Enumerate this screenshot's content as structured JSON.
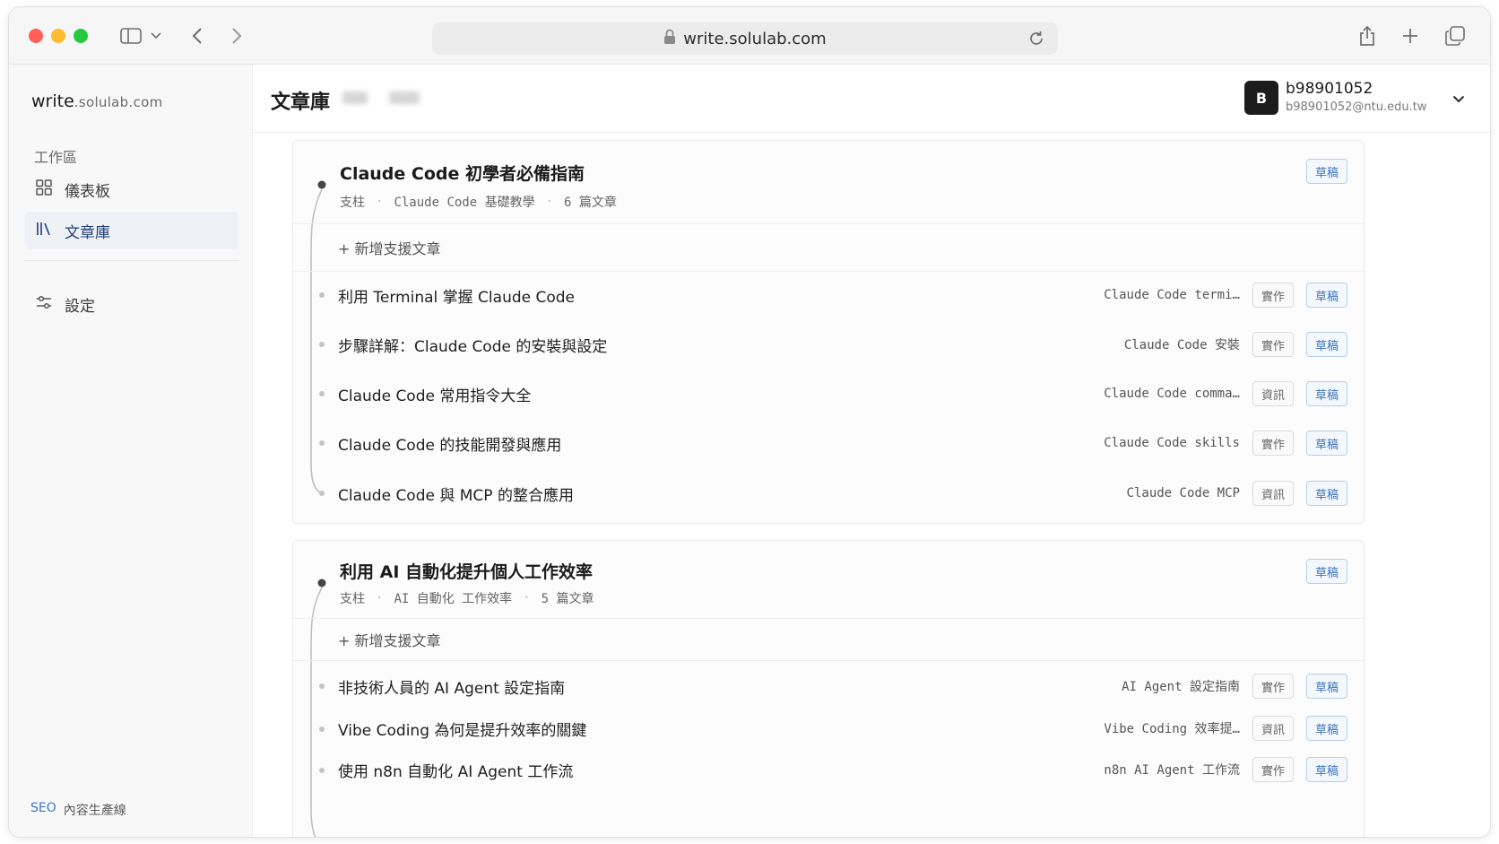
{
  "browser": {
    "url": "write.solulab.com"
  },
  "sidebar": {
    "brand_name": "write",
    "brand_domain": ".solulab.com",
    "section_label": "工作區",
    "items": [
      {
        "label": "儀表板",
        "icon": "grid-icon"
      },
      {
        "label": "文章庫",
        "icon": "library-icon",
        "active": true
      },
      {
        "label": "設定",
        "icon": "sliders-icon"
      }
    ],
    "footer_seo": "SEO",
    "footer_text": "內容生產線"
  },
  "header": {
    "title": "文章庫",
    "user_initial": "B",
    "user_name": "b98901052",
    "user_email": "b98901052@ntu.edu.tw"
  },
  "pillars": [
    {
      "title": "Claude Code 初學者必備指南",
      "kind": "支柱",
      "keyword": "Claude Code 基礎教學",
      "count": "6 篇文章",
      "status": "草稿",
      "add_label": "+ 新增支援文章",
      "articles": [
        {
          "title": "利用 Terminal 掌握 Claude Code",
          "keyword": "Claude Code termi…",
          "type": "實作",
          "status": "草稿"
        },
        {
          "title": "步驟詳解：Claude Code 的安裝與設定",
          "keyword": "Claude Code 安裝",
          "type": "實作",
          "status": "草稿"
        },
        {
          "title": "Claude Code 常用指令大全",
          "keyword": "Claude Code comma…",
          "type": "資訊",
          "status": "草稿"
        },
        {
          "title": "Claude Code 的技能開發與應用",
          "keyword": "Claude Code skills",
          "type": "實作",
          "status": "草稿"
        },
        {
          "title": "Claude Code 與 MCP 的整合應用",
          "keyword": "Claude Code MCP",
          "type": "資訊",
          "status": "草稿"
        }
      ]
    },
    {
      "title": "利用 AI 自動化提升個人工作效率",
      "kind": "支柱",
      "keyword": "AI 自動化 工作效率",
      "count": "5 篇文章",
      "status": "草稿",
      "add_label": "+ 新增支援文章",
      "articles": [
        {
          "title": "非技術人員的 AI Agent 設定指南",
          "keyword": "AI Agent 設定指南",
          "type": "實作",
          "status": "草稿"
        },
        {
          "title": "Vibe Coding 為何是提升效率的關鍵",
          "keyword": "Vibe Coding 效率提…",
          "type": "資訊",
          "status": "草稿"
        },
        {
          "title": "使用 n8n 自動化 AI Agent 工作流",
          "keyword": "n8n AI Agent 工作流",
          "type": "實作",
          "status": "草稿"
        }
      ]
    }
  ],
  "colors": {
    "draft_badge": "#3f73b8",
    "active_nav": "#1f3f74",
    "traffic_red": "#fe5f57",
    "traffic_yellow": "#febc2e",
    "traffic_green": "#28c840"
  }
}
